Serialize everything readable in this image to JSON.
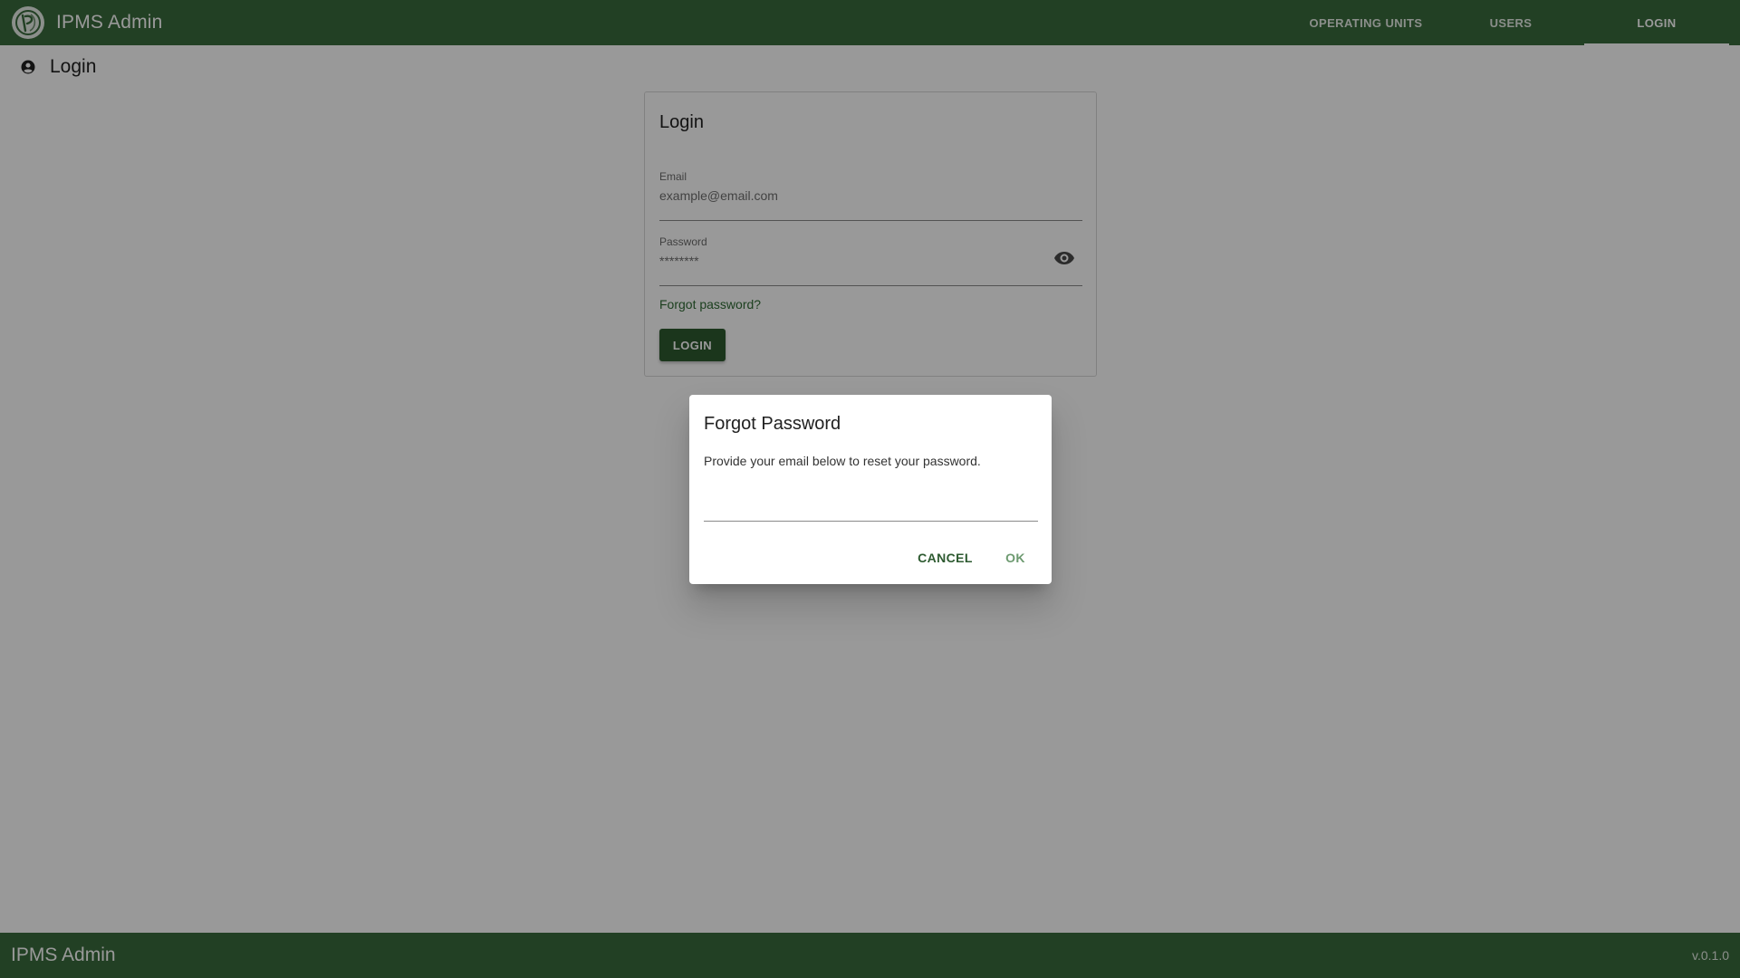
{
  "header": {
    "app_title": "IPMS Admin",
    "nav": [
      {
        "label": "OPERATING UNITS",
        "active": false
      },
      {
        "label": "USERS",
        "active": false
      },
      {
        "label": "LOGIN",
        "active": true
      }
    ]
  },
  "page": {
    "heading": "Login",
    "heading_icon": "account-circle-icon"
  },
  "login_card": {
    "title": "Login",
    "email": {
      "label": "Email",
      "placeholder": "example@email.com",
      "value": ""
    },
    "password": {
      "label": "Password",
      "placeholder": "********",
      "value": ""
    },
    "password_toggle_icon": "eye-icon",
    "forgot_link": "Forgot password?",
    "login_button": "LOGIN"
  },
  "dialog": {
    "title": "Forgot Password",
    "text": "Provide your email below to reset your password.",
    "input_value": "",
    "cancel_label": "CANCEL",
    "ok_label": "OK"
  },
  "footer": {
    "app_title": "IPMS Admin",
    "version": "v.0.1.0"
  },
  "colors": {
    "brand": "#3a6b3c",
    "button": "#2d5a30",
    "link": "#2f6b34"
  }
}
